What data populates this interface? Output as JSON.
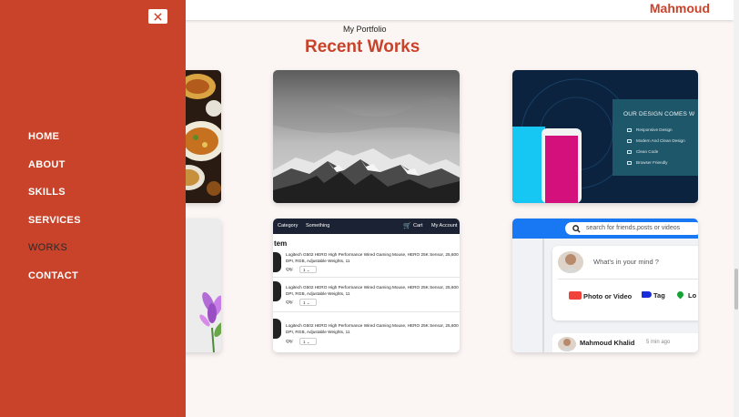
{
  "header": {
    "brand": "Mahmoud"
  },
  "portfolio": {
    "eyebrow": "My Portfolio",
    "title": "Recent Works"
  },
  "sidebar": {
    "close_label": "✕",
    "items": [
      {
        "label": "HOME"
      },
      {
        "label": "ABOUT"
      },
      {
        "label": "SKILLS"
      },
      {
        "label": "SERVICES"
      },
      {
        "label": "WORKS",
        "active": true
      },
      {
        "label": "CONTACT"
      }
    ]
  },
  "works": {
    "design": {
      "title": "OUR DESIGN COMES W",
      "features": [
        "Responsive Design",
        "Modern And Clean Design",
        "Clean Code",
        "Browser Friendly"
      ]
    },
    "shop": {
      "nav": [
        "Category",
        "Something",
        "Cart",
        "My Account"
      ],
      "heading": "tem",
      "items": [
        {
          "desc": "Logitech G502 HERO High Performance Wired Gaming Mouse, HERO 25K Sensor, 25,600 DPI, RGB, Adjustable Weights, 11",
          "qty_label": "Qty:",
          "qty": "1"
        },
        {
          "desc": "Logitech G502 HERO High Performance Wired Gaming Mouse, HERO 25K Sensor, 25,600 DPI, RGB, Adjustable Weights, 11",
          "qty_label": "Qty:",
          "qty": "1"
        },
        {
          "desc": "Logitech G502 HERO High Performance Wired Gaming Mouse, HERO 25K Sensor, 25,600 DPI, RGB, Adjustable Weights, 11",
          "qty_label": "Qty:",
          "qty": "1"
        }
      ]
    },
    "social": {
      "search_placeholder": "search for friends,posts or videos",
      "prompt": "What's in your mind ?",
      "actions": [
        "Photo or Video",
        "Tag",
        "Lo"
      ],
      "feed_name": "Mahmoud Khalid",
      "feed_time": "5 min ago"
    }
  },
  "colors": {
    "accent": "#c9432a",
    "page_bg": "#fbf5f4",
    "social_blue": "#1877f2"
  }
}
